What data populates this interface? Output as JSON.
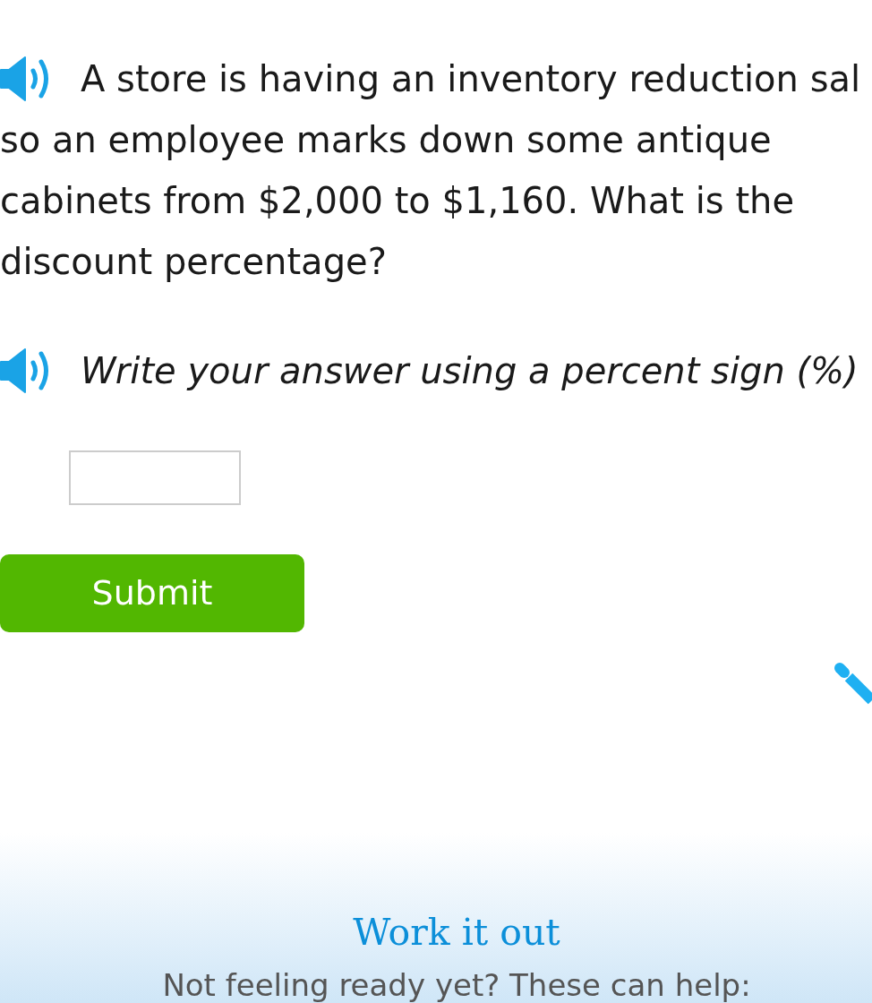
{
  "question": {
    "lines": [
      "A store is having an inventory reduction sal",
      "so an employee marks down some antique",
      "cabinets from $2,000 to $1,160. What is the",
      "discount percentage?"
    ]
  },
  "instruction": {
    "text": "Write your answer using a percent sign (%)"
  },
  "submit_button": {
    "label": "Submit"
  },
  "work_it_out": {
    "title": "Work it out",
    "subtitle": "Not feeling ready yet? These can help:"
  }
}
